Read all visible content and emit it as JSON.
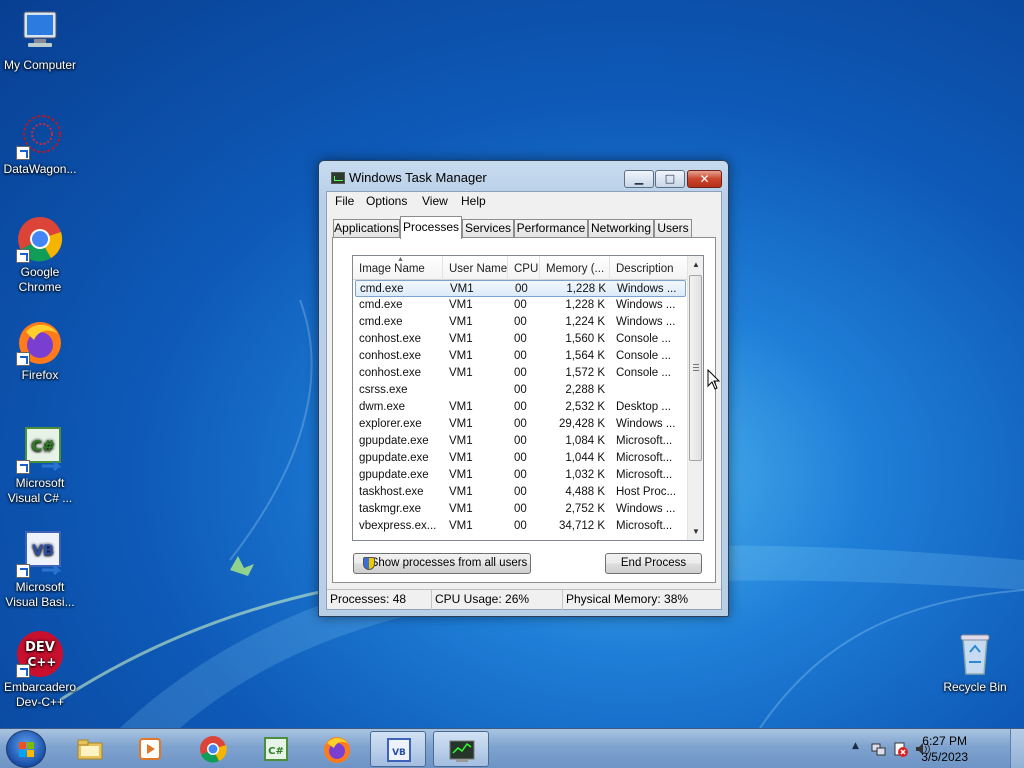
{
  "desktop": {
    "icons": [
      {
        "label_line1": "My Computer",
        "label_line2": ""
      },
      {
        "label_line1": "DataWagon...",
        "label_line2": ""
      },
      {
        "label_line1": "Google",
        "label_line2": "Chrome"
      },
      {
        "label_line1": "Firefox",
        "label_line2": ""
      },
      {
        "label_line1": "Microsoft",
        "label_line2": "Visual C# ..."
      },
      {
        "label_line1": "Microsoft",
        "label_line2": "Visual Basi..."
      },
      {
        "label_line1": "Embarcadero",
        "label_line2": "Dev-C++"
      },
      {
        "label_line1": "Recycle Bin",
        "label_line2": ""
      }
    ]
  },
  "window": {
    "title": "Windows Task Manager",
    "min_glyph": "▁",
    "max_glyph": "□",
    "close_glyph": "✕"
  },
  "menu": [
    "File",
    "Options",
    "View",
    "Help"
  ],
  "tabs": [
    "Applications",
    "Processes",
    "Services",
    "Performance",
    "Networking",
    "Users"
  ],
  "active_tab": "Processes",
  "processes": {
    "columns": [
      "Image Name",
      "User Name",
      "CPU",
      "Memory (...",
      "Description"
    ],
    "rows": [
      [
        "cmd.exe",
        "VM1",
        "00",
        "1,228 K",
        "Windows ..."
      ],
      [
        "cmd.exe",
        "VM1",
        "00",
        "1,228 K",
        "Windows ..."
      ],
      [
        "cmd.exe",
        "VM1",
        "00",
        "1,224 K",
        "Windows ..."
      ],
      [
        "conhost.exe",
        "VM1",
        "00",
        "1,560 K",
        "Console ..."
      ],
      [
        "conhost.exe",
        "VM1",
        "00",
        "1,564 K",
        "Console ..."
      ],
      [
        "conhost.exe",
        "VM1",
        "00",
        "1,572 K",
        "Console ..."
      ],
      [
        "csrss.exe",
        "",
        "00",
        "2,288 K",
        ""
      ],
      [
        "dwm.exe",
        "VM1",
        "00",
        "2,532 K",
        "Desktop ..."
      ],
      [
        "explorer.exe",
        "VM1",
        "00",
        "29,428 K",
        "Windows ..."
      ],
      [
        "gpupdate.exe",
        "VM1",
        "00",
        "1,084 K",
        "Microsoft..."
      ],
      [
        "gpupdate.exe",
        "VM1",
        "00",
        "1,044 K",
        "Microsoft..."
      ],
      [
        "gpupdate.exe",
        "VM1",
        "00",
        "1,032 K",
        "Microsoft..."
      ],
      [
        "taskhost.exe",
        "VM1",
        "00",
        "4,488 K",
        "Host Proc..."
      ],
      [
        "taskmgr.exe",
        "VM1",
        "00",
        "2,752 K",
        "Windows ..."
      ],
      [
        "vbexpress.ex...",
        "VM1",
        "00",
        "34,712 K",
        "Microsoft..."
      ]
    ],
    "selected_row": 0
  },
  "buttons": {
    "show_all": "Show processes from all users",
    "end_process": "End Process"
  },
  "status": {
    "processes": "Processes: 48",
    "cpu": "CPU Usage: 26%",
    "memory": "Physical Memory: 38%"
  },
  "taskbar": {
    "time": "6:27 PM",
    "date": "3/5/2023"
  },
  "colors": {
    "accent": "#1a5fd0",
    "titlebar": "#c7dbef",
    "selection_border": "#7da2ce",
    "close_button": "#c9452b"
  }
}
